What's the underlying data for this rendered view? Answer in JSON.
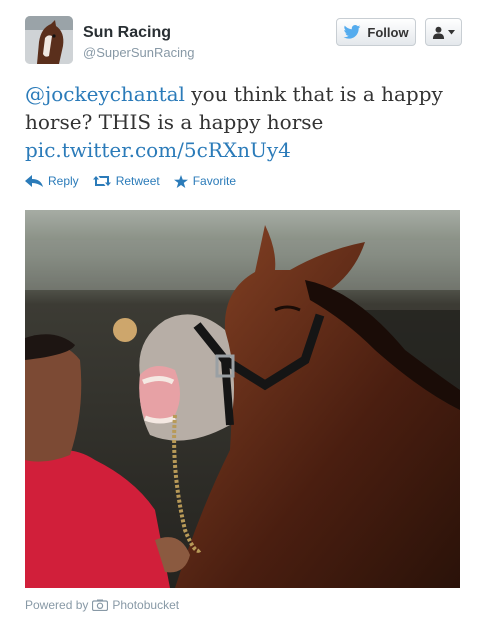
{
  "user": {
    "name": "Sun Racing",
    "handle": "@SuperSunRacing"
  },
  "follow": {
    "label": "Follow"
  },
  "tweet": {
    "mention": "@jockeychantal",
    "text": " you think that is a happy horse? THIS is a happy horse ",
    "link": "pic.twitter.com/5cRXnUy4"
  },
  "actions": {
    "reply": "Reply",
    "retweet": "Retweet",
    "favorite": "Favorite"
  },
  "footer": {
    "powered_by": "Powered by",
    "provider": "Photobucket"
  },
  "colors": {
    "link": "#2b7bb9",
    "twitter_bird": "#55acee"
  }
}
